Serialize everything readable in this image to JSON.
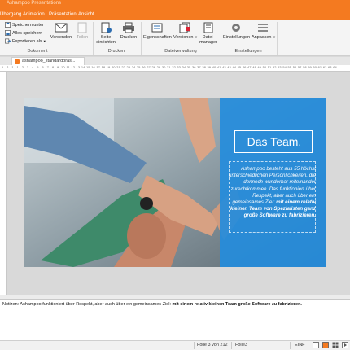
{
  "window": {
    "title": "Ashampoo Presentations"
  },
  "menu": {
    "tabs": [
      "Übergang",
      "Animation",
      "Präsentation",
      "Ansicht"
    ]
  },
  "ribbon": {
    "dokument": {
      "save_as": "Speichern unter",
      "save_all": "Alles speichern",
      "export": "Exportieren als",
      "label": "Dokument"
    },
    "senden": {
      "send": "Versenden",
      "share": "Teilen"
    },
    "drucken": {
      "page_setup_line1": "Seite",
      "page_setup_line2": "einrichten",
      "print": "Drucken",
      "label": "Drucken"
    },
    "dateiverwaltung": {
      "properties": "Eigenschaften",
      "versions": "Versionen",
      "file_manager_line1": "Datei-",
      "file_manager_line2": "manager",
      "label": "Dateiverwaltung"
    },
    "einstellungen": {
      "settings": "Einstellungen",
      "customize": "Anpassen",
      "label": "Einstellungen"
    }
  },
  "doc_tab": {
    "name": "ashampoo_standardpräs..."
  },
  "ruler": {
    "marks": [
      "1",
      "2",
      "1",
      "1",
      "2",
      "3",
      "4",
      "5",
      "6",
      "7",
      "8",
      "9",
      "10",
      "11",
      "12",
      "13",
      "14",
      "15",
      "16",
      "17",
      "18",
      "19",
      "20",
      "21",
      "22",
      "23",
      "24",
      "25",
      "26",
      "27",
      "28",
      "29",
      "30",
      "31",
      "32",
      "33",
      "34",
      "35",
      "36",
      "37",
      "38",
      "39",
      "40",
      "41",
      "42",
      "43",
      "44",
      "45",
      "46",
      "47",
      "48",
      "49",
      "50",
      "51",
      "52",
      "53",
      "54",
      "55",
      "56",
      "57",
      "58",
      "59",
      "60",
      "61",
      "62",
      "63",
      "64"
    ]
  },
  "slide": {
    "title": "Das Team.",
    "body_plain": "Ashampoo besteht aus 55 höchst unterschiedlichen Persönlichkeiten, die dennoch wunderbar miteinander zurechtkommen. Das funktioniert über Respekt, aber auch über ein gemeinsames Ziel:",
    "body_bold": "mit einem relativ kleinen Team von Spezialisten ganz große Software zu fabrizieren."
  },
  "notes": {
    "plain": "Notizen: Ashampoo funktioniert über Respekt, aber auch über ein gemeinsames Ziel: ",
    "bold": "mit einem relativ kleinen Team große Software zu fabrizieren."
  },
  "status": {
    "slide_pos": "Folie 3 von 212",
    "slide_name": "Folie3",
    "mode": "EINF"
  },
  "colors": {
    "accent": "#f47a20",
    "slide_blue": "#248cdc"
  }
}
